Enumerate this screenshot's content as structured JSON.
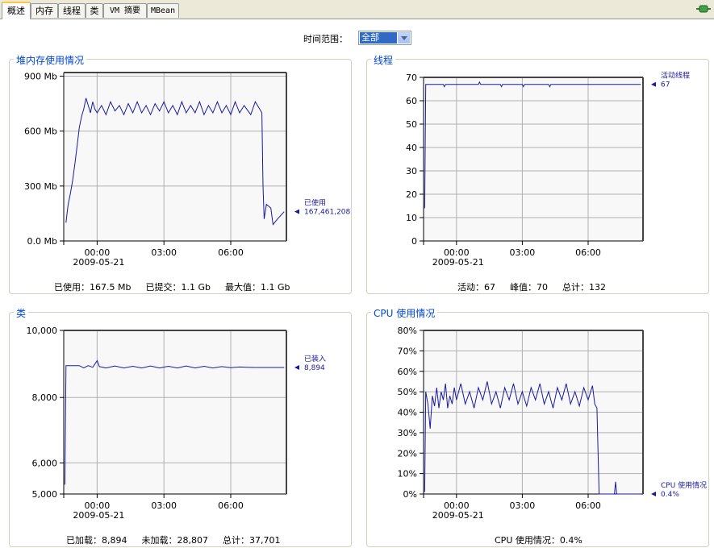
{
  "tabs": [
    "概述",
    "内存",
    "线程",
    "类",
    "VM 摘要",
    "MBean"
  ],
  "time_range": {
    "label": "时间范围：",
    "selected": "全部"
  },
  "panels": {
    "heap": {
      "title": "堆内存使用情况",
      "footer": [
        "已使用：167.5 Mb",
        "已提交：1.1 Gb",
        "最大值：1.1 Gb"
      ]
    },
    "threads": {
      "title": "线程",
      "footer": [
        "活动：67",
        "峰值：70",
        "总计：132"
      ]
    },
    "classes": {
      "title": "类",
      "footer": [
        "已加载：8,894",
        "未加载：28,807",
        "总计：37,701"
      ]
    },
    "cpu": {
      "title": "CPU 使用情况",
      "footer": [
        "CPU 使用情况：0.4%"
      ]
    }
  },
  "chart_data": [
    {
      "type": "line",
      "id": "heap",
      "title": "堆内存使用情况",
      "x_ticks": [
        {
          "v": 0,
          "label": "00:00"
        },
        {
          "v": 3,
          "label": "03:00"
        },
        {
          "v": 6,
          "label": "06:00"
        }
      ],
      "x_sub": "2009-05-21",
      "xlim": [
        -1.5,
        8.5
      ],
      "y_ticks": [
        {
          "v": 0,
          "label": "0.0 Mb"
        },
        {
          "v": 300,
          "label": "300 Mb"
        },
        {
          "v": 600,
          "label": "600 Mb"
        },
        {
          "v": 900,
          "label": "900 Mb"
        }
      ],
      "ylim": [
        0,
        920
      ],
      "series": [
        {
          "name": "已使用",
          "value_label": "167,461,208",
          "points": [
            [
              -1.4,
              100
            ],
            [
              -1.35,
              150
            ],
            [
              -1.3,
              200
            ],
            [
              -1.2,
              260
            ],
            [
              -1.1,
              330
            ],
            [
              -1.0,
              420
            ],
            [
              -0.9,
              520
            ],
            [
              -0.8,
              620
            ],
            [
              -0.7,
              680
            ],
            [
              -0.6,
              720
            ],
            [
              -0.5,
              780
            ],
            [
              -0.4,
              740
            ],
            [
              -0.3,
              700
            ],
            [
              -0.2,
              760
            ],
            [
              -0.1,
              720
            ],
            [
              0.0,
              700
            ],
            [
              0.2,
              740
            ],
            [
              0.4,
              690
            ],
            [
              0.6,
              760
            ],
            [
              0.8,
              710
            ],
            [
              1.0,
              740
            ],
            [
              1.2,
              690
            ],
            [
              1.4,
              750
            ],
            [
              1.6,
              700
            ],
            [
              1.8,
              760
            ],
            [
              2.0,
              700
            ],
            [
              2.2,
              740
            ],
            [
              2.4,
              690
            ],
            [
              2.6,
              750
            ],
            [
              2.8,
              710
            ],
            [
              3.0,
              760
            ],
            [
              3.2,
              700
            ],
            [
              3.4,
              740
            ],
            [
              3.6,
              690
            ],
            [
              3.8,
              760
            ],
            [
              4.0,
              700
            ],
            [
              4.2,
              740
            ],
            [
              4.4,
              700
            ],
            [
              4.6,
              760
            ],
            [
              4.8,
              690
            ],
            [
              5.0,
              740
            ],
            [
              5.2,
              700
            ],
            [
              5.4,
              760
            ],
            [
              5.6,
              700
            ],
            [
              5.8,
              740
            ],
            [
              6.0,
              690
            ],
            [
              6.2,
              760
            ],
            [
              6.4,
              700
            ],
            [
              6.6,
              740
            ],
            [
              6.9,
              690
            ],
            [
              7.1,
              760
            ],
            [
              7.3,
              720
            ],
            [
              7.4,
              700
            ],
            [
              7.45,
              300
            ],
            [
              7.5,
              120
            ],
            [
              7.6,
              200
            ],
            [
              7.8,
              180
            ],
            [
              7.9,
              90
            ],
            [
              8.1,
              120
            ],
            [
              8.4,
              160
            ]
          ]
        }
      ]
    },
    {
      "type": "line",
      "id": "threads",
      "title": "线程",
      "x_ticks": [
        {
          "v": 0,
          "label": "00:00"
        },
        {
          "v": 3,
          "label": "03:00"
        },
        {
          "v": 6,
          "label": "06:00"
        }
      ],
      "x_sub": "2009-05-21",
      "xlim": [
        -1.5,
        8.5
      ],
      "y_ticks": [
        {
          "v": 0,
          "label": "0"
        },
        {
          "v": 10,
          "label": "10"
        },
        {
          "v": 20,
          "label": "20"
        },
        {
          "v": 30,
          "label": "30"
        },
        {
          "v": 40,
          "label": "40"
        },
        {
          "v": 50,
          "label": "50"
        },
        {
          "v": 60,
          "label": "60"
        },
        {
          "v": 70,
          "label": "70"
        }
      ],
      "ylim": [
        0,
        70
      ],
      "series": [
        {
          "name": "活动线程",
          "value_label": "67",
          "points": [
            [
              -1.45,
              14
            ],
            [
              -1.4,
              67
            ],
            [
              -0.6,
              67
            ],
            [
              -0.55,
              66
            ],
            [
              -0.5,
              67
            ],
            [
              1.0,
              67
            ],
            [
              1.05,
              68
            ],
            [
              1.1,
              67
            ],
            [
              2.0,
              67
            ],
            [
              2.05,
              66
            ],
            [
              2.1,
              67
            ],
            [
              3.0,
              67
            ],
            [
              3.05,
              66
            ],
            [
              3.1,
              67
            ],
            [
              4.2,
              67
            ],
            [
              4.25,
              66
            ],
            [
              4.3,
              67
            ],
            [
              8.4,
              67
            ]
          ]
        }
      ]
    },
    {
      "type": "line",
      "id": "classes",
      "title": "类",
      "x_ticks": [
        {
          "v": 0,
          "label": "00:00"
        },
        {
          "v": 3,
          "label": "03:00"
        },
        {
          "v": 6,
          "label": "06:00"
        }
      ],
      "x_sub": "2009-05-21",
      "xlim": [
        -1.5,
        8.5
      ],
      "y_ticks": [
        {
          "v": 5000,
          "label": "5,000"
        },
        {
          "v": 6000,
          "label": "6,000"
        },
        {
          "v": 8000,
          "label": "8,000"
        },
        {
          "v": 10000,
          "label": "10,000"
        }
      ],
      "ylim": [
        5000,
        10000
      ],
      "y_scale": "nonlinear",
      "series": [
        {
          "name": "已装入",
          "value_label": "8,894",
          "points": [
            [
              -1.45,
              5300
            ],
            [
              -1.4,
              8950
            ],
            [
              -0.8,
              8950
            ],
            [
              -0.6,
              8880
            ],
            [
              -0.4,
              8950
            ],
            [
              -0.2,
              8900
            ],
            [
              0.0,
              9100
            ],
            [
              0.1,
              8920
            ],
            [
              0.4,
              8880
            ],
            [
              0.8,
              8940
            ],
            [
              1.2,
              8880
            ],
            [
              1.6,
              8930
            ],
            [
              2.0,
              8880
            ],
            [
              2.4,
              8940
            ],
            [
              2.8,
              8880
            ],
            [
              3.2,
              8930
            ],
            [
              3.6,
              8880
            ],
            [
              4.0,
              8940
            ],
            [
              4.4,
              8880
            ],
            [
              4.8,
              8930
            ],
            [
              5.2,
              8880
            ],
            [
              5.6,
              8920
            ],
            [
              6.0,
              8890
            ],
            [
              6.4,
              8910
            ],
            [
              7.0,
              8894
            ],
            [
              8.4,
              8894
            ]
          ]
        }
      ]
    },
    {
      "type": "line",
      "id": "cpu",
      "title": "CPU 使用情况",
      "x_ticks": [
        {
          "v": 0,
          "label": "00:00"
        },
        {
          "v": 3,
          "label": "03:00"
        },
        {
          "v": 6,
          "label": "06:00"
        }
      ],
      "x_sub": "2009-05-21",
      "xlim": [
        -1.5,
        8.5
      ],
      "y_ticks": [
        {
          "v": 0,
          "label": "0%"
        },
        {
          "v": 10,
          "label": "10%"
        },
        {
          "v": 20,
          "label": "20%"
        },
        {
          "v": 30,
          "label": "30%"
        },
        {
          "v": 40,
          "label": "40%"
        },
        {
          "v": 50,
          "label": "50%"
        },
        {
          "v": 60,
          "label": "60%"
        },
        {
          "v": 70,
          "label": "70%"
        },
        {
          "v": 80,
          "label": "80%"
        }
      ],
      "ylim": [
        0,
        80
      ],
      "series": [
        {
          "name": "CPU 使用情况",
          "value_label": "0.4%",
          "points": [
            [
              -1.45,
              1
            ],
            [
              -1.4,
              50
            ],
            [
              -1.3,
              44
            ],
            [
              -1.2,
              32
            ],
            [
              -1.1,
              48
            ],
            [
              -1.0,
              43
            ],
            [
              -0.9,
              52
            ],
            [
              -0.8,
              42
            ],
            [
              -0.7,
              50
            ],
            [
              -0.6,
              46
            ],
            [
              -0.5,
              54
            ],
            [
              -0.4,
              42
            ],
            [
              -0.3,
              48
            ],
            [
              -0.2,
              44
            ],
            [
              -0.1,
              52
            ],
            [
              0.0,
              46
            ],
            [
              0.2,
              54
            ],
            [
              0.4,
              44
            ],
            [
              0.6,
              50
            ],
            [
              0.8,
              42
            ],
            [
              1.0,
              52
            ],
            [
              1.2,
              46
            ],
            [
              1.4,
              55
            ],
            [
              1.6,
              44
            ],
            [
              1.8,
              50
            ],
            [
              2.0,
              42
            ],
            [
              2.2,
              52
            ],
            [
              2.4,
              46
            ],
            [
              2.6,
              54
            ],
            [
              2.8,
              44
            ],
            [
              3.0,
              50
            ],
            [
              3.2,
              43
            ],
            [
              3.4,
              52
            ],
            [
              3.6,
              46
            ],
            [
              3.8,
              54
            ],
            [
              4.0,
              44
            ],
            [
              4.2,
              50
            ],
            [
              4.4,
              42
            ],
            [
              4.6,
              52
            ],
            [
              4.8,
              46
            ],
            [
              5.0,
              54
            ],
            [
              5.2,
              44
            ],
            [
              5.4,
              50
            ],
            [
              5.6,
              43
            ],
            [
              5.8,
              52
            ],
            [
              6.0,
              46
            ],
            [
              6.2,
              53
            ],
            [
              6.3,
              44
            ],
            [
              6.4,
              42
            ],
            [
              6.5,
              0
            ],
            [
              7.2,
              0
            ],
            [
              7.25,
              6
            ],
            [
              7.3,
              0
            ],
            [
              8.4,
              0
            ]
          ]
        }
      ]
    }
  ]
}
